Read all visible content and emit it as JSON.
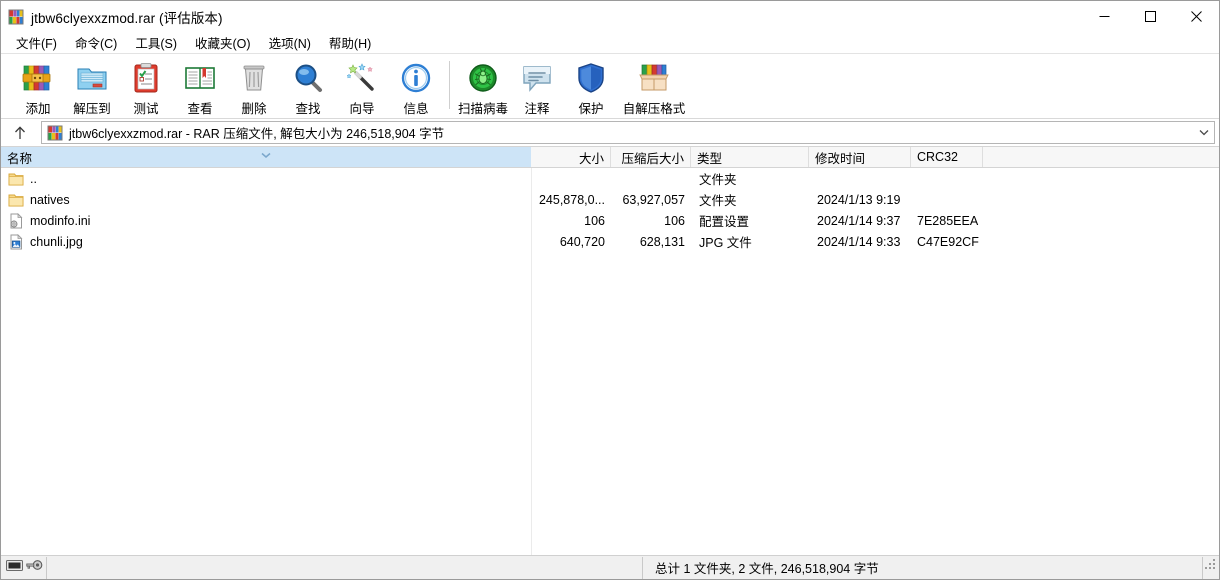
{
  "window": {
    "title": "jtbw6clyexxzmod.rar (评估版本)",
    "icon": "winrar-books-icon",
    "controls": {
      "minimize": "–",
      "maximize": "□",
      "close": "✕"
    }
  },
  "menubar": {
    "items": [
      {
        "label": "文件(F)",
        "name": "menu-file"
      },
      {
        "label": "命令(C)",
        "name": "menu-commands"
      },
      {
        "label": "工具(S)",
        "name": "menu-tools"
      },
      {
        "label": "收藏夹(O)",
        "name": "menu-favorites"
      },
      {
        "label": "选项(N)",
        "name": "menu-options"
      },
      {
        "label": "帮助(H)",
        "name": "menu-help"
      }
    ]
  },
  "toolbar": {
    "buttons": [
      {
        "label": "添加",
        "icon": "add-archive-icon",
        "name": "toolbar-add"
      },
      {
        "label": "解压到",
        "icon": "extract-to-icon",
        "name": "toolbar-extract-to"
      },
      {
        "label": "测试",
        "icon": "test-clipboard-icon",
        "name": "toolbar-test"
      },
      {
        "label": "查看",
        "icon": "view-book-icon",
        "name": "toolbar-view"
      },
      {
        "label": "删除",
        "icon": "delete-trash-icon",
        "name": "toolbar-delete"
      },
      {
        "label": "查找",
        "icon": "find-magnifier-icon",
        "name": "toolbar-find"
      },
      {
        "label": "向导",
        "icon": "wizard-wand-icon",
        "name": "toolbar-wizard"
      },
      {
        "label": "信息",
        "icon": "info-circle-icon",
        "name": "toolbar-info"
      },
      {
        "label": "扫描病毒",
        "icon": "virus-scan-icon",
        "name": "toolbar-virus-scan"
      },
      {
        "label": "注释",
        "icon": "comment-icon",
        "name": "toolbar-comment"
      },
      {
        "label": "保护",
        "icon": "shield-icon",
        "name": "toolbar-protect"
      },
      {
        "label": "自解压格式",
        "icon": "sfx-box-icon",
        "name": "toolbar-sfx"
      }
    ]
  },
  "addressbar": {
    "up_tooltip": "↑",
    "icon": "winrar-books-icon",
    "text": "jtbw6clyexxzmod.rar - RAR 压缩文件, 解包大小为 246,518,904 字节",
    "dropdown": "chevron-down-icon"
  },
  "filelist": {
    "columns": [
      {
        "label": "名称",
        "name": "column-name",
        "align": "left",
        "sorted": true
      },
      {
        "label": "大小",
        "name": "column-size",
        "align": "right",
        "sorted": false
      },
      {
        "label": "压缩后大小",
        "name": "column-packed",
        "align": "right",
        "sorted": false
      },
      {
        "label": "类型",
        "name": "column-type",
        "align": "left",
        "sorted": false
      },
      {
        "label": "修改时间",
        "name": "column-mtime",
        "align": "left",
        "sorted": false
      },
      {
        "label": "CRC32",
        "name": "column-crc32",
        "align": "left",
        "sorted": false
      }
    ],
    "rows": [
      {
        "name": "..",
        "icon": "folder-icon",
        "size": "",
        "packed": "",
        "type": "文件夹",
        "mtime": "",
        "crc32": ""
      },
      {
        "name": "natives",
        "icon": "folder-icon",
        "size": "245,878,0...",
        "packed": "63,927,057",
        "type": "文件夹",
        "mtime": "2024/1/13 9:19",
        "crc32": ""
      },
      {
        "name": "modinfo.ini",
        "icon": "ini-file-icon",
        "size": "106",
        "packed": "106",
        "type": "配置设置",
        "mtime": "2024/1/14 9:37",
        "crc32": "7E285EEA"
      },
      {
        "name": "chunli.jpg",
        "icon": "jpg-file-icon",
        "size": "640,720",
        "packed": "628,131",
        "type": "JPG 文件",
        "mtime": "2024/1/14 9:33",
        "crc32": "C47E92CF"
      }
    ]
  },
  "statusbar": {
    "icons": [
      "drive-icon",
      "key-icon"
    ],
    "text": "总计 1 文件夹, 2 文件, 246,518,904 字节"
  },
  "colors": {
    "sorted_header": "#cde4f7",
    "header_bg": "#f7f7f7",
    "status_bg": "#f0f0f0",
    "folder_yellow": "#f5d07a"
  }
}
